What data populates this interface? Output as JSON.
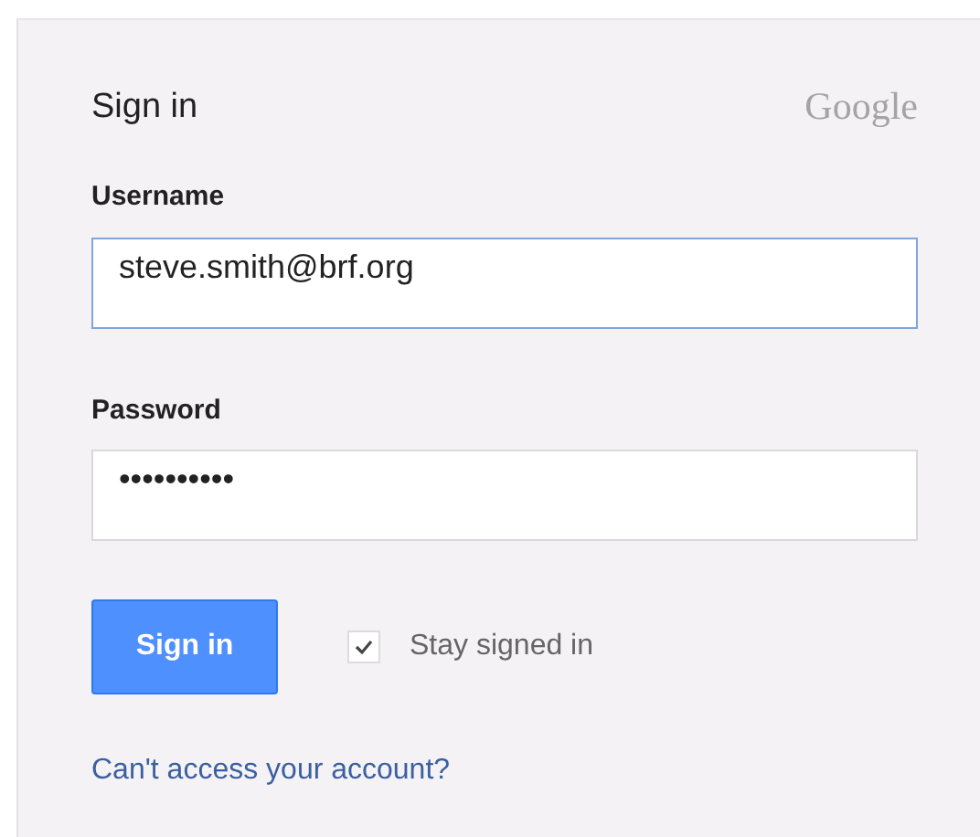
{
  "title": "Sign in",
  "logo": "Google",
  "fields": [
    {
      "label": "Username",
      "value": "steve.smith@brf.org",
      "focused": true
    },
    {
      "label": "Password",
      "value": "••••••••••",
      "focused": false
    }
  ],
  "submit": "Sign in",
  "stay_signed_in": {
    "label": "Stay signed in",
    "checked": true
  },
  "help_link": "Can't access your account?"
}
